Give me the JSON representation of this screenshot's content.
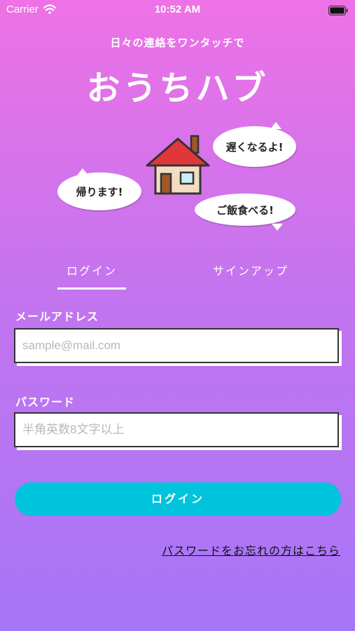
{
  "status_bar": {
    "carrier": "Carrier",
    "time": "10:52 AM"
  },
  "header": {
    "tagline": "日々の連絡をワンタッチで",
    "title": "おうちハブ"
  },
  "illustration": {
    "bubbles": [
      "遅くなるよ!",
      "帰ります!",
      "ご飯食べる!"
    ],
    "colors": {
      "roof": "#e0373a",
      "wall": "#f3dcc2",
      "door": "#a0572a",
      "window": "#c9eef7"
    }
  },
  "tabs": [
    {
      "label": "ログイン",
      "active": true
    },
    {
      "label": "サインアップ",
      "active": false
    }
  ],
  "form": {
    "email_label": "メールアドレス",
    "email_placeholder": "sample@mail.com",
    "password_label": "パスワード",
    "password_placeholder": "半角英数8文字以上"
  },
  "login_button": "ログイン",
  "forgot_password": "パスワードをお忘れの方はこちら",
  "colors": {
    "gradient_top": "#ee72e6",
    "gradient_bottom": "#a676f8",
    "button": "#00c3dc"
  }
}
